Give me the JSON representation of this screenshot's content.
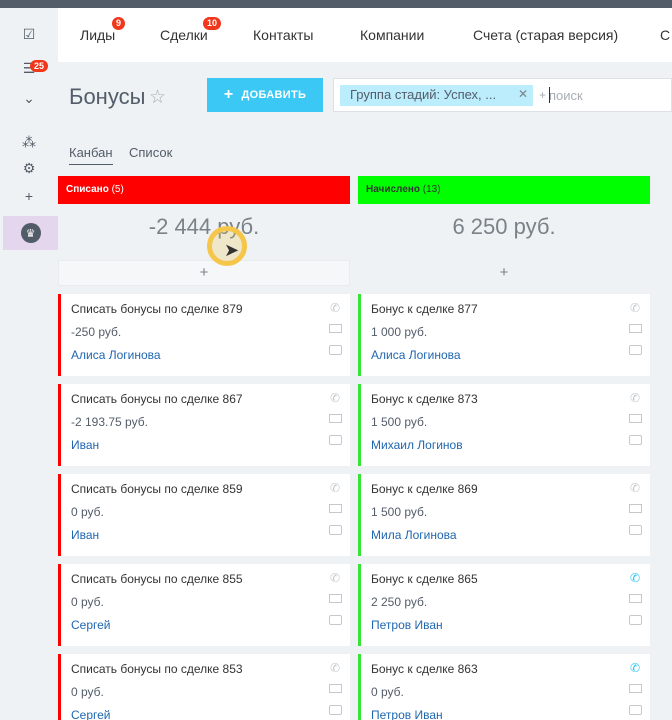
{
  "sidebar": {
    "badge": "25",
    "icons": [
      "task-icon",
      "filter-icon",
      "chevron-down-icon",
      "sitemap-icon",
      "gear-icon",
      "plus-icon",
      "crown-icon"
    ]
  },
  "topnav": {
    "items": [
      {
        "label": "Лиды",
        "badge": "9"
      },
      {
        "label": "Сделки",
        "badge": "10"
      },
      {
        "label": "Контакты"
      },
      {
        "label": "Компании"
      },
      {
        "label": "Счета (старая версия)"
      },
      {
        "label": "С"
      }
    ]
  },
  "page": {
    "title": "Бонусы",
    "add_button": "ДОБАВИТЬ",
    "filter_chip": "Группа стадий: Успех, ...",
    "search_placeholder": "поиск",
    "views": [
      "Канбан",
      "Список"
    ]
  },
  "columns": [
    {
      "title": "Списано",
      "count": "(5)",
      "color": "#ff0000",
      "sum": "-2 444 руб.",
      "cards": [
        {
          "title": "Списать бонусы по сделке 879",
          "amount": "-250 руб.",
          "person": "Алиса Логинова",
          "phone_active": false
        },
        {
          "title": "Списать бонусы по сделке 867",
          "amount": "-2 193.75 руб.",
          "person": "Иван",
          "phone_active": false
        },
        {
          "title": "Списать бонусы по сделке 859",
          "amount": "0 руб.",
          "person": "Иван",
          "phone_active": false
        },
        {
          "title": "Списать бонусы по сделке 855",
          "amount": "0 руб.",
          "person": "Сергей",
          "phone_active": false
        },
        {
          "title": "Списать бонусы по сделке 853",
          "amount": "0 руб.",
          "person": "Сергей",
          "phone_active": false
        }
      ]
    },
    {
      "title": "Начислено",
      "count": "(13)",
      "color": "#00ff00",
      "sum": "6 250 руб.",
      "cards": [
        {
          "title": "Бонус к сделке 877",
          "amount": "1 000 руб.",
          "person": "Алиса Логинова",
          "phone_active": false
        },
        {
          "title": "Бонус к сделке 873",
          "amount": "1 500 руб.",
          "person": "Михаил Логинов",
          "phone_active": false
        },
        {
          "title": "Бонус к сделке 869",
          "amount": "1 500 руб.",
          "person": "Мила Логинова",
          "phone_active": false
        },
        {
          "title": "Бонус к сделке 865",
          "amount": "2 250 руб.",
          "person": "Петров Иван",
          "phone_active": true
        },
        {
          "title": "Бонус к сделке 863",
          "amount": "0 руб.",
          "person": "Петров Иван",
          "phone_active": true
        }
      ]
    }
  ]
}
